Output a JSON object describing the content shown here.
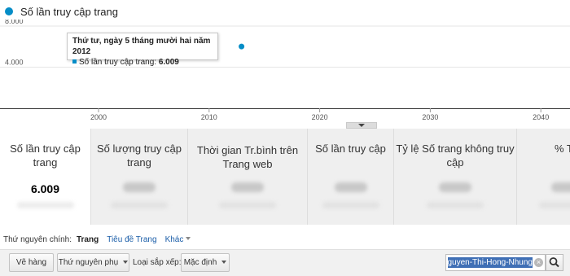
{
  "legend": {
    "label": "Số lần truy cập trang",
    "color": "#058dc7"
  },
  "chart_data": {
    "type": "scatter",
    "series": [
      {
        "name": "Số lần truy cập trang",
        "color": "#058dc7",
        "points": [
          {
            "x": 2012.93,
            "y": 6009
          }
        ]
      }
    ],
    "x_ticks": [
      "2000",
      "2010",
      "2020",
      "2030",
      "2040"
    ],
    "x_tick_values": [
      2000,
      2010,
      2020,
      2030,
      2040
    ],
    "y_ticks": [
      "8.000",
      "4.000"
    ],
    "y_tick_values": [
      8000,
      4000
    ],
    "ylim": [
      0,
      8000
    ],
    "grid": true,
    "tooltip": {
      "date": "Thứ tư, ngày 5 tháng mười hai năm 2012",
      "metric": "Số lần truy cập trang:",
      "value": "6.009"
    }
  },
  "metrics": [
    {
      "name": "Số lần truy cập trang",
      "value": "6.009",
      "selected": true
    },
    {
      "name": "Số lượng truy cập trang",
      "value": ""
    },
    {
      "name": "Thời gian Tr.bình trên Trang web",
      "value": ""
    },
    {
      "name": "Số lần truy cập",
      "value": ""
    },
    {
      "name": "Tỷ lệ Số trang không truy cập",
      "value": ""
    },
    {
      "name": "% T",
      "value": ""
    }
  ],
  "dimension_bar": {
    "label": "Thứ nguyên chính:",
    "current": "Trang",
    "link": "Tiêu đề Trang",
    "other": "Khác"
  },
  "toolbar": {
    "plot_rows": "Vẽ hàng",
    "secondary_dimension": "Thứ nguyên phụ",
    "sort_label": "Loại sắp xếp:",
    "sort_value": "Mặc định",
    "search_value": "nguyen-Thi-Hong-Nhung"
  }
}
